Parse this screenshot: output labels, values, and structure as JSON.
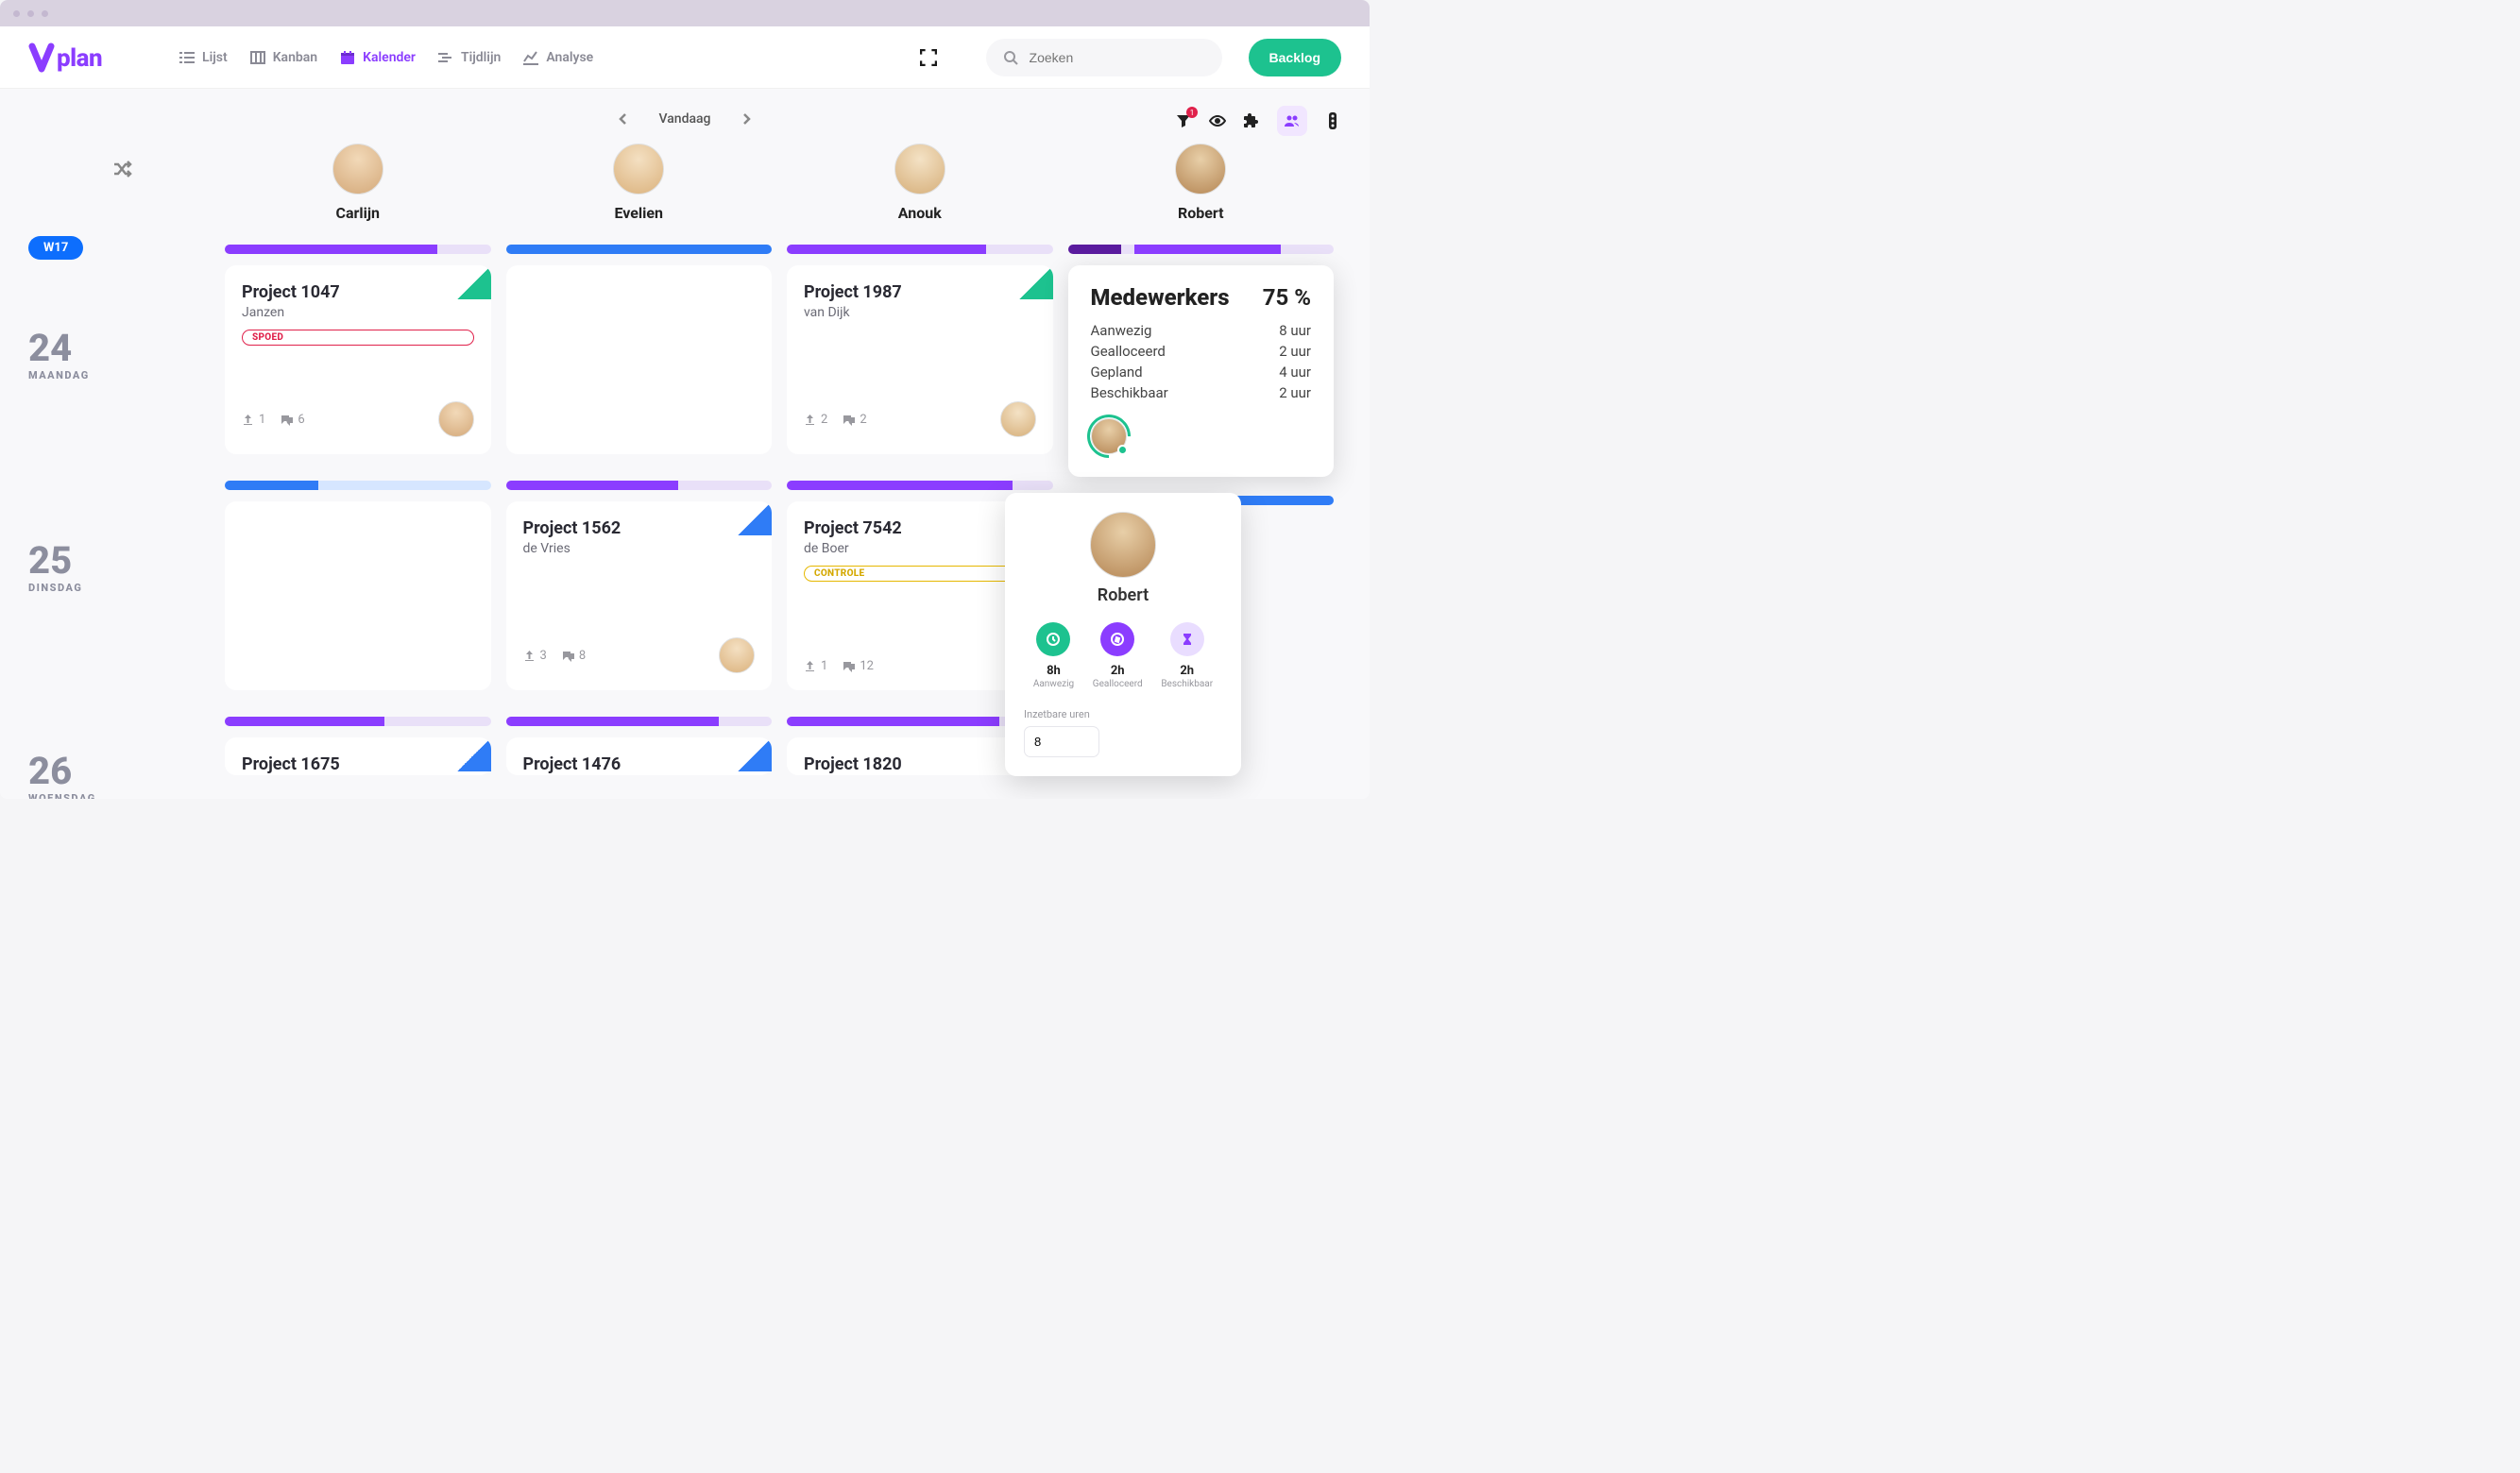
{
  "brand": "vplan",
  "nav": {
    "lijst": "Lijst",
    "kanban": "Kanban",
    "kalender": "Kalender",
    "tijdlijn": "Tijdlijn",
    "analyse": "Analyse"
  },
  "search": {
    "placeholder": "Zoeken"
  },
  "backlog": "Backlog",
  "dateNav": {
    "today": "Vandaag"
  },
  "filterBadge": "1",
  "week": "W17",
  "people": [
    {
      "name": "Carlijn"
    },
    {
      "name": "Evelien"
    },
    {
      "name": "Anouk"
    },
    {
      "name": "Robert"
    }
  ],
  "days": [
    {
      "num": "24",
      "name": "MAANDAG"
    },
    {
      "num": "25",
      "name": "DINSDAG"
    },
    {
      "num": "26",
      "name": "WOENSDAG"
    }
  ],
  "cards": {
    "carlijn_24": {
      "title": "Project 1047",
      "sub": "Janzen",
      "tag": "SPOED",
      "uploads": "1",
      "comments": "6"
    },
    "anouk_24": {
      "title": "Project 1987",
      "sub": "van Dijk",
      "uploads": "2",
      "comments": "2"
    },
    "evelien_25": {
      "title": "Project 1562",
      "sub": "de Vries",
      "uploads": "3",
      "comments": "8"
    },
    "anouk_25": {
      "title": "Project 7542",
      "sub": "de Boer",
      "tag": "CONTROLE",
      "uploads": "1",
      "comments": "12"
    },
    "carlijn_26": {
      "title": "Project 1675"
    },
    "evelien_26": {
      "title": "Project 1476"
    },
    "anouk_26": {
      "title": "Project 1820"
    }
  },
  "medewerkersPanel": {
    "title": "Medewerkers",
    "pct": "75 %",
    "metrics": [
      {
        "label": "Aanwezig",
        "value": "8 uur"
      },
      {
        "label": "Gealloceerd",
        "value": "2 uur"
      },
      {
        "label": "Gepland",
        "value": "4 uur"
      },
      {
        "label": "Beschikbaar",
        "value": "2 uur"
      }
    ]
  },
  "popup": {
    "name": "Robert",
    "stats": [
      {
        "val": "8h",
        "lbl": "Aanwezig"
      },
      {
        "val": "2h",
        "lbl": "Gealloceerd"
      },
      {
        "val": "2h",
        "lbl": "Beschikbaar"
      }
    ],
    "fieldLabel": "Inzetbare uren",
    "fieldValue": "8"
  },
  "colors": {
    "purple": "#8b3dff",
    "blue": "#2f7cf6",
    "green": "#1dc28f",
    "lavender": "#e9e0f8",
    "darkPurple": "#5a1b9e"
  }
}
